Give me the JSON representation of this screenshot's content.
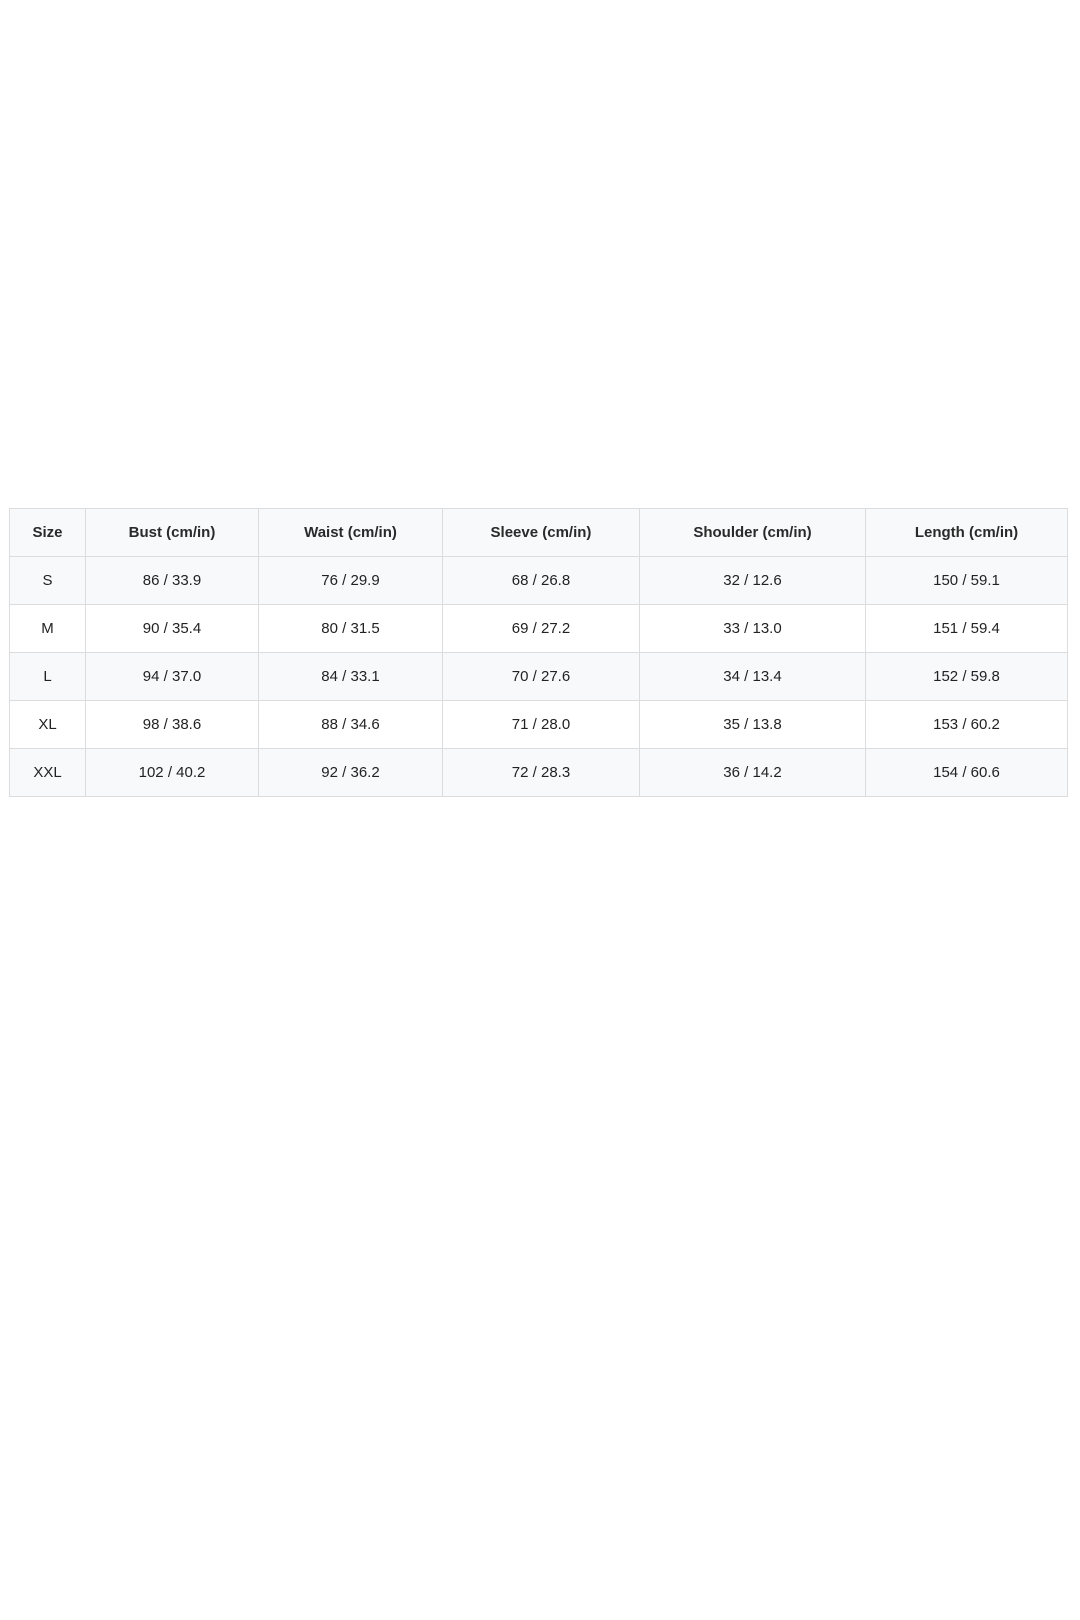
{
  "size_chart": {
    "headers": [
      "Size",
      "Bust (cm/in)",
      "Waist (cm/in)",
      "Sleeve (cm/in)",
      "Shoulder (cm/in)",
      "Length (cm/in)"
    ],
    "rows": [
      [
        "S",
        "86 / 33.9",
        "76 / 29.9",
        "68 / 26.8",
        "32 / 12.6",
        "150 / 59.1"
      ],
      [
        "M",
        "90 / 35.4",
        "80 / 31.5",
        "69 / 27.2",
        "33 / 13.0",
        "151 / 59.4"
      ],
      [
        "L",
        "94 / 37.0",
        "84 / 33.1",
        "70 / 27.6",
        "34 / 13.4",
        "152 / 59.8"
      ],
      [
        "XL",
        "98 / 38.6",
        "88 / 34.6",
        "71 / 28.0",
        "35 / 13.8",
        "153 / 60.2"
      ],
      [
        "XXL",
        "102 / 40.2",
        "92 / 36.2",
        "72 / 28.3",
        "36 / 14.2",
        "154 / 60.6"
      ]
    ]
  }
}
